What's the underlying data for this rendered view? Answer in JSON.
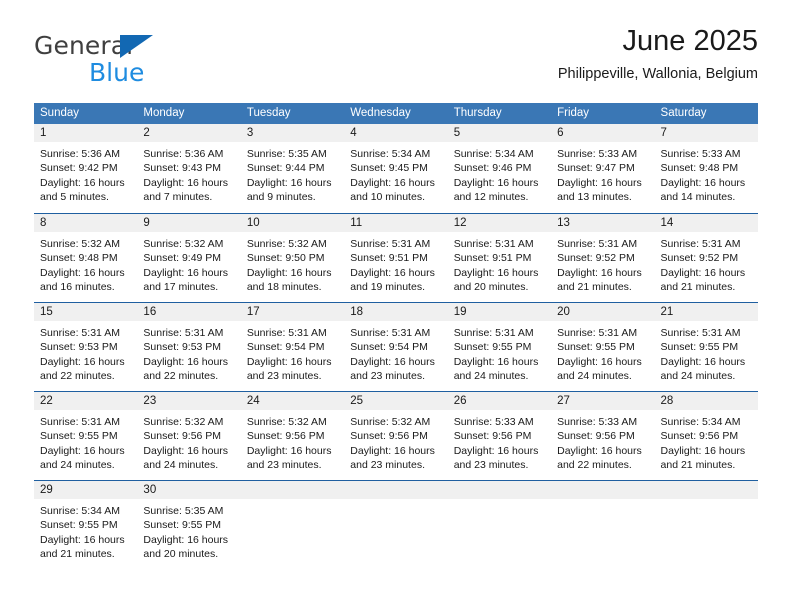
{
  "brand": {
    "name_part1": "General",
    "name_part2": "Blue"
  },
  "header": {
    "title": "June 2025",
    "subtitle": "Philippeville, Wallonia, Belgium"
  },
  "colors": {
    "header_blue": "#3a77b5",
    "row_divider_blue": "#1f5fa0",
    "day_number_bg": "#f0f0f0",
    "logo_blue": "#1f8ce0",
    "logo_triangle_blue": "#1268b3",
    "text": "#1a1a1a"
  },
  "weekdays": [
    "Sunday",
    "Monday",
    "Tuesday",
    "Wednesday",
    "Thursday",
    "Friday",
    "Saturday"
  ],
  "weeks": [
    [
      {
        "day": "1",
        "sunrise": "Sunrise: 5:36 AM",
        "sunset": "Sunset: 9:42 PM",
        "daylight": "Daylight: 16 hours and 5 minutes."
      },
      {
        "day": "2",
        "sunrise": "Sunrise: 5:36 AM",
        "sunset": "Sunset: 9:43 PM",
        "daylight": "Daylight: 16 hours and 7 minutes."
      },
      {
        "day": "3",
        "sunrise": "Sunrise: 5:35 AM",
        "sunset": "Sunset: 9:44 PM",
        "daylight": "Daylight: 16 hours and 9 minutes."
      },
      {
        "day": "4",
        "sunrise": "Sunrise: 5:34 AM",
        "sunset": "Sunset: 9:45 PM",
        "daylight": "Daylight: 16 hours and 10 minutes."
      },
      {
        "day": "5",
        "sunrise": "Sunrise: 5:34 AM",
        "sunset": "Sunset: 9:46 PM",
        "daylight": "Daylight: 16 hours and 12 minutes."
      },
      {
        "day": "6",
        "sunrise": "Sunrise: 5:33 AM",
        "sunset": "Sunset: 9:47 PM",
        "daylight": "Daylight: 16 hours and 13 minutes."
      },
      {
        "day": "7",
        "sunrise": "Sunrise: 5:33 AM",
        "sunset": "Sunset: 9:48 PM",
        "daylight": "Daylight: 16 hours and 14 minutes."
      }
    ],
    [
      {
        "day": "8",
        "sunrise": "Sunrise: 5:32 AM",
        "sunset": "Sunset: 9:48 PM",
        "daylight": "Daylight: 16 hours and 16 minutes."
      },
      {
        "day": "9",
        "sunrise": "Sunrise: 5:32 AM",
        "sunset": "Sunset: 9:49 PM",
        "daylight": "Daylight: 16 hours and 17 minutes."
      },
      {
        "day": "10",
        "sunrise": "Sunrise: 5:32 AM",
        "sunset": "Sunset: 9:50 PM",
        "daylight": "Daylight: 16 hours and 18 minutes."
      },
      {
        "day": "11",
        "sunrise": "Sunrise: 5:31 AM",
        "sunset": "Sunset: 9:51 PM",
        "daylight": "Daylight: 16 hours and 19 minutes."
      },
      {
        "day": "12",
        "sunrise": "Sunrise: 5:31 AM",
        "sunset": "Sunset: 9:51 PM",
        "daylight": "Daylight: 16 hours and 20 minutes."
      },
      {
        "day": "13",
        "sunrise": "Sunrise: 5:31 AM",
        "sunset": "Sunset: 9:52 PM",
        "daylight": "Daylight: 16 hours and 21 minutes."
      },
      {
        "day": "14",
        "sunrise": "Sunrise: 5:31 AM",
        "sunset": "Sunset: 9:52 PM",
        "daylight": "Daylight: 16 hours and 21 minutes."
      }
    ],
    [
      {
        "day": "15",
        "sunrise": "Sunrise: 5:31 AM",
        "sunset": "Sunset: 9:53 PM",
        "daylight": "Daylight: 16 hours and 22 minutes."
      },
      {
        "day": "16",
        "sunrise": "Sunrise: 5:31 AM",
        "sunset": "Sunset: 9:53 PM",
        "daylight": "Daylight: 16 hours and 22 minutes."
      },
      {
        "day": "17",
        "sunrise": "Sunrise: 5:31 AM",
        "sunset": "Sunset: 9:54 PM",
        "daylight": "Daylight: 16 hours and 23 minutes."
      },
      {
        "day": "18",
        "sunrise": "Sunrise: 5:31 AM",
        "sunset": "Sunset: 9:54 PM",
        "daylight": "Daylight: 16 hours and 23 minutes."
      },
      {
        "day": "19",
        "sunrise": "Sunrise: 5:31 AM",
        "sunset": "Sunset: 9:55 PM",
        "daylight": "Daylight: 16 hours and 24 minutes."
      },
      {
        "day": "20",
        "sunrise": "Sunrise: 5:31 AM",
        "sunset": "Sunset: 9:55 PM",
        "daylight": "Daylight: 16 hours and 24 minutes."
      },
      {
        "day": "21",
        "sunrise": "Sunrise: 5:31 AM",
        "sunset": "Sunset: 9:55 PM",
        "daylight": "Daylight: 16 hours and 24 minutes."
      }
    ],
    [
      {
        "day": "22",
        "sunrise": "Sunrise: 5:31 AM",
        "sunset": "Sunset: 9:55 PM",
        "daylight": "Daylight: 16 hours and 24 minutes."
      },
      {
        "day": "23",
        "sunrise": "Sunrise: 5:32 AM",
        "sunset": "Sunset: 9:56 PM",
        "daylight": "Daylight: 16 hours and 24 minutes."
      },
      {
        "day": "24",
        "sunrise": "Sunrise: 5:32 AM",
        "sunset": "Sunset: 9:56 PM",
        "daylight": "Daylight: 16 hours and 23 minutes."
      },
      {
        "day": "25",
        "sunrise": "Sunrise: 5:32 AM",
        "sunset": "Sunset: 9:56 PM",
        "daylight": "Daylight: 16 hours and 23 minutes."
      },
      {
        "day": "26",
        "sunrise": "Sunrise: 5:33 AM",
        "sunset": "Sunset: 9:56 PM",
        "daylight": "Daylight: 16 hours and 23 minutes."
      },
      {
        "day": "27",
        "sunrise": "Sunrise: 5:33 AM",
        "sunset": "Sunset: 9:56 PM",
        "daylight": "Daylight: 16 hours and 22 minutes."
      },
      {
        "day": "28",
        "sunrise": "Sunrise: 5:34 AM",
        "sunset": "Sunset: 9:56 PM",
        "daylight": "Daylight: 16 hours and 21 minutes."
      }
    ],
    [
      {
        "day": "29",
        "sunrise": "Sunrise: 5:34 AM",
        "sunset": "Sunset: 9:55 PM",
        "daylight": "Daylight: 16 hours and 21 minutes."
      },
      {
        "day": "30",
        "sunrise": "Sunrise: 5:35 AM",
        "sunset": "Sunset: 9:55 PM",
        "daylight": "Daylight: 16 hours and 20 minutes."
      },
      {
        "day": "",
        "sunrise": "",
        "sunset": "",
        "daylight": ""
      },
      {
        "day": "",
        "sunrise": "",
        "sunset": "",
        "daylight": ""
      },
      {
        "day": "",
        "sunrise": "",
        "sunset": "",
        "daylight": ""
      },
      {
        "day": "",
        "sunrise": "",
        "sunset": "",
        "daylight": ""
      },
      {
        "day": "",
        "sunrise": "",
        "sunset": "",
        "daylight": ""
      }
    ]
  ]
}
